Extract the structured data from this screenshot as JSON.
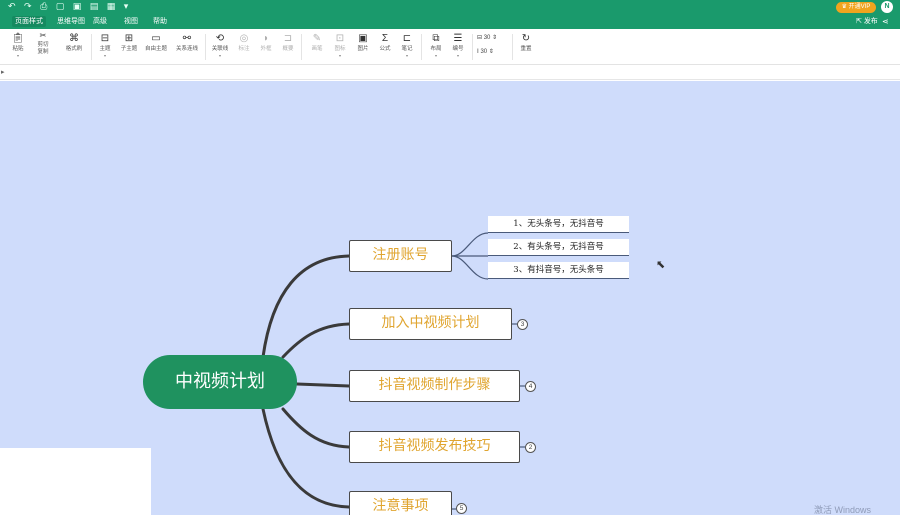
{
  "titlebar": {
    "quick_access": "↶ ↷ ⎙ ▢ ▣ ▤ ▦ ▾",
    "vip_label": "♛ 开通VIP",
    "avatar_letter": "N"
  },
  "menubar": {
    "tabs": [
      "页面样式",
      "思维导图",
      "高级",
      "视图",
      "帮助"
    ],
    "publish_label": "发布",
    "share_icon": "share-icon"
  },
  "toolbar": {
    "paste": "粘贴",
    "cut": "剪切",
    "copy": "复制",
    "format_painter": "格式刷",
    "topic": "主题",
    "subtopic": "子主题",
    "floating_topic": "自由主题",
    "relation": "关系连线",
    "summary": "关联线",
    "comment": "标注",
    "boundary": "外框",
    "outline": "概要",
    "pen": "画笔",
    "icon": "图标",
    "image": "图片",
    "formula": "公式",
    "note": "笔记",
    "layout": "布局",
    "number": "编号",
    "height_value": "30",
    "width_value": "30",
    "reset": "重置"
  },
  "mindmap": {
    "root": "中视频计划",
    "branches": [
      {
        "label": "注册账号",
        "badge": ""
      },
      {
        "label": "加入中视频计划",
        "badge": "3"
      },
      {
        "label": "抖音视频制作步骤",
        "badge": "4"
      },
      {
        "label": "抖音视频发布技巧",
        "badge": "2"
      },
      {
        "label": "注意事项",
        "badge": "5"
      }
    ],
    "leaves": [
      "1、无头条号，无抖音号",
      "2、有头条号，无抖音号",
      "3、有抖音号，无头条号"
    ],
    "colors": {
      "canvas": "#cfdcfb",
      "root": "#1f925f",
      "branch_text": "#e0a530",
      "edge": "#3a3a3a"
    }
  },
  "watermark": "激活 Windows"
}
